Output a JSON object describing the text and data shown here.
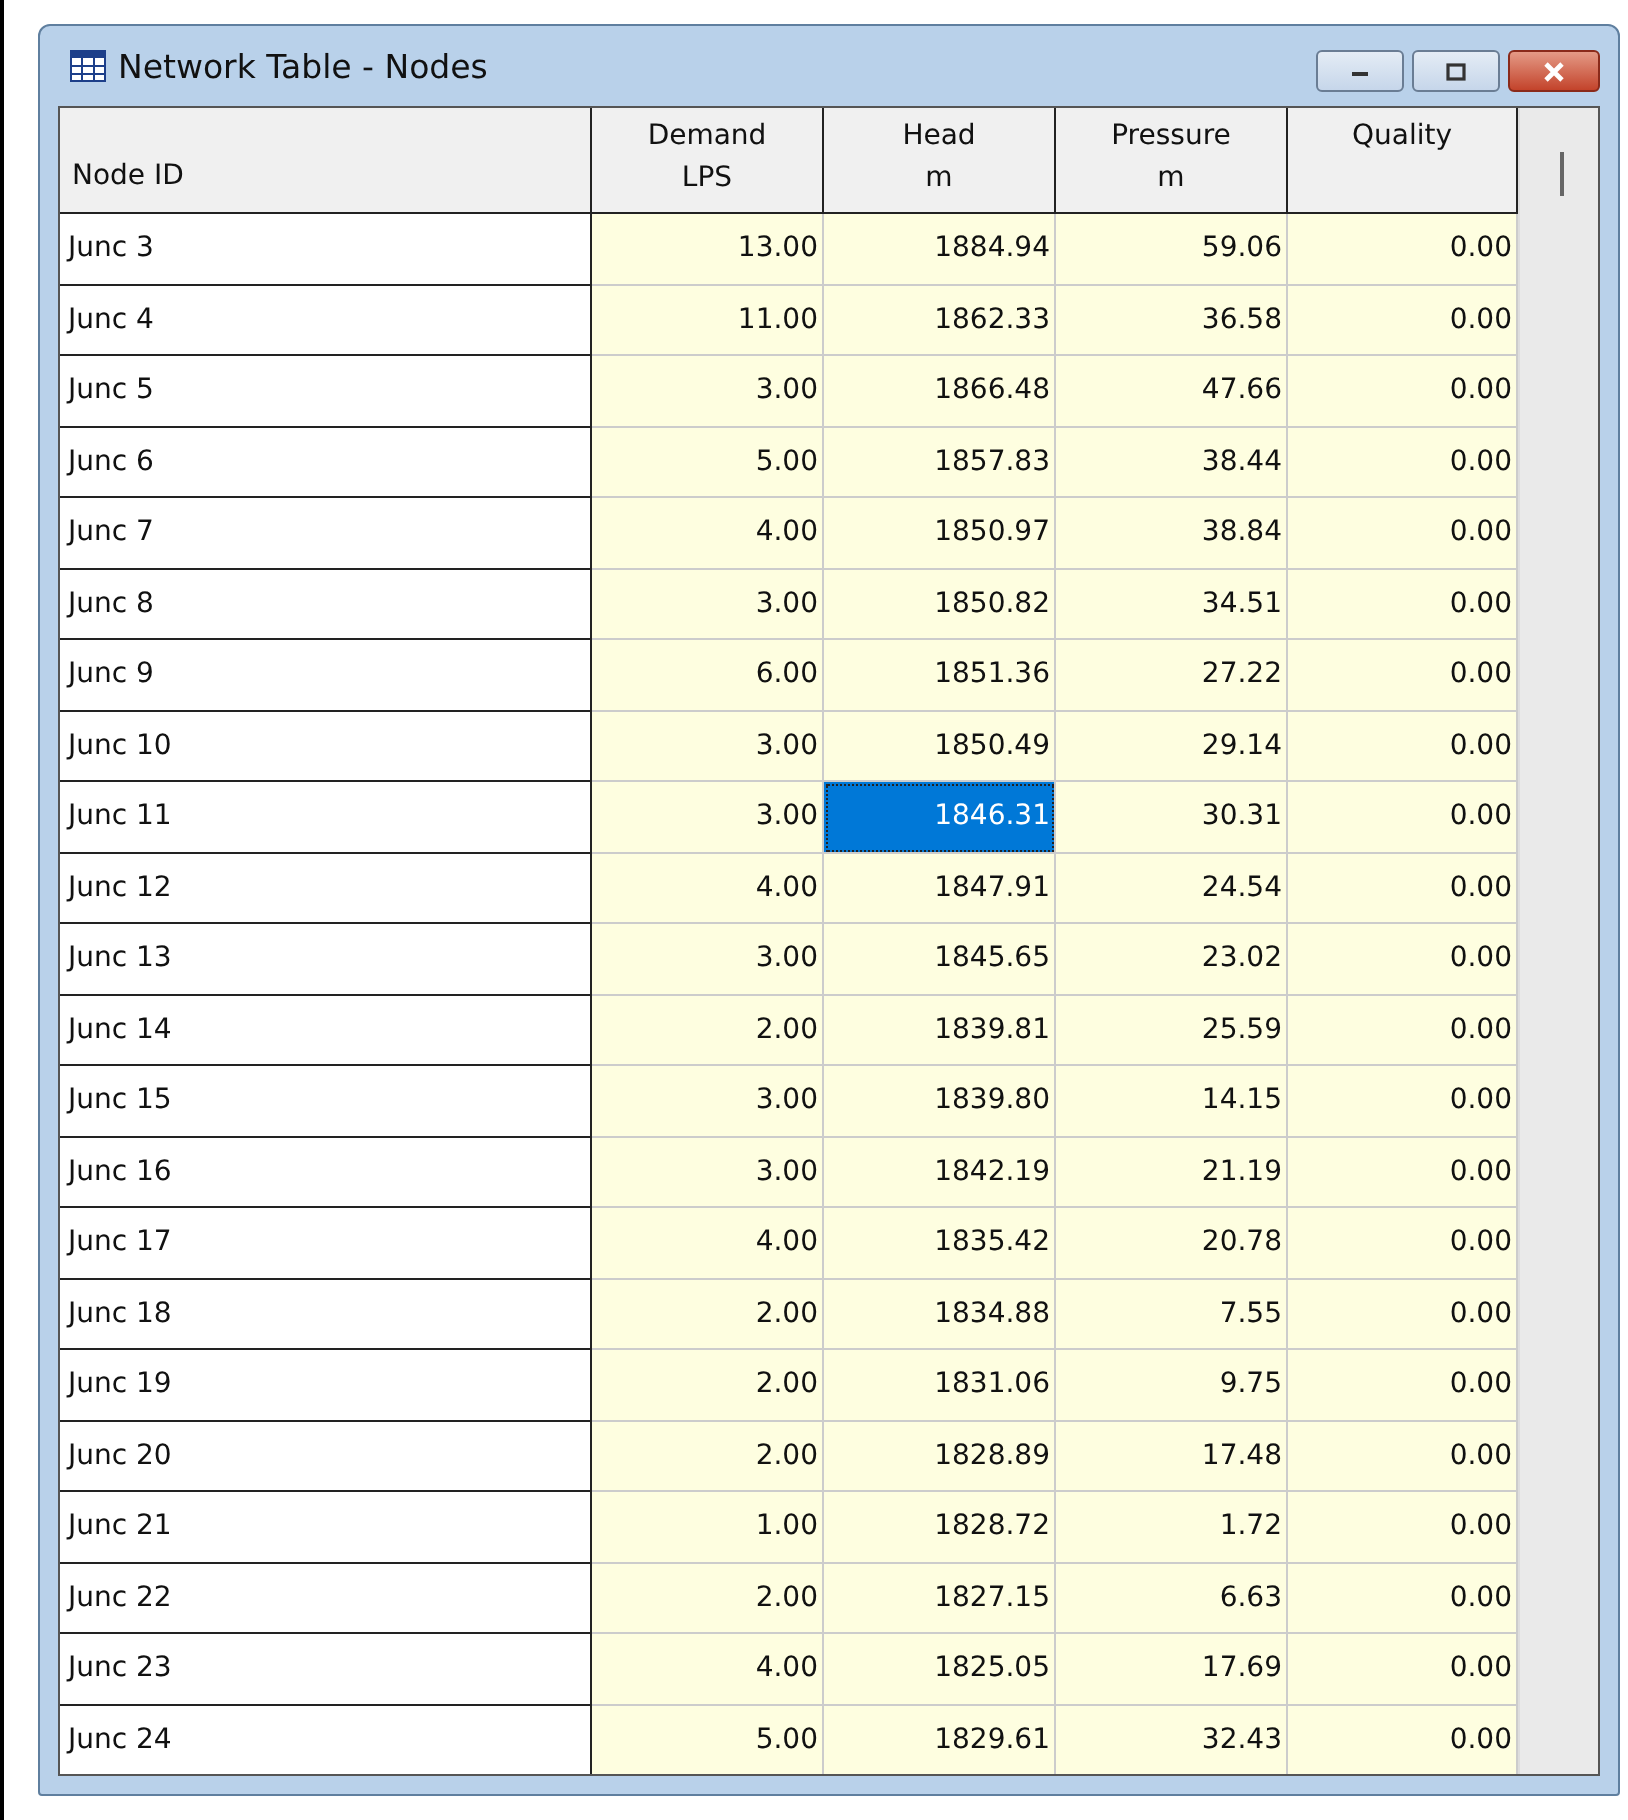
{
  "window": {
    "title": "Network Table - Nodes"
  },
  "table": {
    "columns": [
      {
        "lines": [
          "Node ID"
        ]
      },
      {
        "lines": [
          "Demand",
          "LPS"
        ]
      },
      {
        "lines": [
          "Head",
          "m"
        ]
      },
      {
        "lines": [
          "Pressure",
          "m"
        ]
      },
      {
        "lines": [
          "Quality"
        ]
      }
    ],
    "rows": [
      {
        "id": "Junc 3",
        "cells": [
          {
            "value": "13.00",
            "selected": false
          },
          {
            "value": "1884.94",
            "selected": false
          },
          {
            "value": "59.06",
            "selected": false
          },
          {
            "value": "0.00",
            "selected": false
          }
        ]
      },
      {
        "id": "Junc 4",
        "cells": [
          {
            "value": "11.00",
            "selected": false
          },
          {
            "value": "1862.33",
            "selected": false
          },
          {
            "value": "36.58",
            "selected": false
          },
          {
            "value": "0.00",
            "selected": false
          }
        ]
      },
      {
        "id": "Junc 5",
        "cells": [
          {
            "value": "3.00",
            "selected": false
          },
          {
            "value": "1866.48",
            "selected": false
          },
          {
            "value": "47.66",
            "selected": false
          },
          {
            "value": "0.00",
            "selected": false
          }
        ]
      },
      {
        "id": "Junc 6",
        "cells": [
          {
            "value": "5.00",
            "selected": false
          },
          {
            "value": "1857.83",
            "selected": false
          },
          {
            "value": "38.44",
            "selected": false
          },
          {
            "value": "0.00",
            "selected": false
          }
        ]
      },
      {
        "id": "Junc 7",
        "cells": [
          {
            "value": "4.00",
            "selected": false
          },
          {
            "value": "1850.97",
            "selected": false
          },
          {
            "value": "38.84",
            "selected": false
          },
          {
            "value": "0.00",
            "selected": false
          }
        ]
      },
      {
        "id": "Junc 8",
        "cells": [
          {
            "value": "3.00",
            "selected": false
          },
          {
            "value": "1850.82",
            "selected": false
          },
          {
            "value": "34.51",
            "selected": false
          },
          {
            "value": "0.00",
            "selected": false
          }
        ]
      },
      {
        "id": "Junc 9",
        "cells": [
          {
            "value": "6.00",
            "selected": false
          },
          {
            "value": "1851.36",
            "selected": false
          },
          {
            "value": "27.22",
            "selected": false
          },
          {
            "value": "0.00",
            "selected": false
          }
        ]
      },
      {
        "id": "Junc 10",
        "cells": [
          {
            "value": "3.00",
            "selected": false
          },
          {
            "value": "1850.49",
            "selected": false
          },
          {
            "value": "29.14",
            "selected": false
          },
          {
            "value": "0.00",
            "selected": false
          }
        ]
      },
      {
        "id": "Junc 11",
        "cells": [
          {
            "value": "3.00",
            "selected": false
          },
          {
            "value": "1846.31",
            "selected": true
          },
          {
            "value": "30.31",
            "selected": false
          },
          {
            "value": "0.00",
            "selected": false
          }
        ]
      },
      {
        "id": "Junc 12",
        "cells": [
          {
            "value": "4.00",
            "selected": false
          },
          {
            "value": "1847.91",
            "selected": false
          },
          {
            "value": "24.54",
            "selected": false
          },
          {
            "value": "0.00",
            "selected": false
          }
        ]
      },
      {
        "id": "Junc 13",
        "cells": [
          {
            "value": "3.00",
            "selected": false
          },
          {
            "value": "1845.65",
            "selected": false
          },
          {
            "value": "23.02",
            "selected": false
          },
          {
            "value": "0.00",
            "selected": false
          }
        ]
      },
      {
        "id": "Junc 14",
        "cells": [
          {
            "value": "2.00",
            "selected": false
          },
          {
            "value": "1839.81",
            "selected": false
          },
          {
            "value": "25.59",
            "selected": false
          },
          {
            "value": "0.00",
            "selected": false
          }
        ]
      },
      {
        "id": "Junc 15",
        "cells": [
          {
            "value": "3.00",
            "selected": false
          },
          {
            "value": "1839.80",
            "selected": false
          },
          {
            "value": "14.15",
            "selected": false
          },
          {
            "value": "0.00",
            "selected": false
          }
        ]
      },
      {
        "id": "Junc 16",
        "cells": [
          {
            "value": "3.00",
            "selected": false
          },
          {
            "value": "1842.19",
            "selected": false
          },
          {
            "value": "21.19",
            "selected": false
          },
          {
            "value": "0.00",
            "selected": false
          }
        ]
      },
      {
        "id": "Junc 17",
        "cells": [
          {
            "value": "4.00",
            "selected": false
          },
          {
            "value": "1835.42",
            "selected": false
          },
          {
            "value": "20.78",
            "selected": false
          },
          {
            "value": "0.00",
            "selected": false
          }
        ]
      },
      {
        "id": "Junc 18",
        "cells": [
          {
            "value": "2.00",
            "selected": false
          },
          {
            "value": "1834.88",
            "selected": false
          },
          {
            "value": "7.55",
            "selected": false
          },
          {
            "value": "0.00",
            "selected": false
          }
        ]
      },
      {
        "id": "Junc 19",
        "cells": [
          {
            "value": "2.00",
            "selected": false
          },
          {
            "value": "1831.06",
            "selected": false
          },
          {
            "value": "9.75",
            "selected": false
          },
          {
            "value": "0.00",
            "selected": false
          }
        ]
      },
      {
        "id": "Junc 20",
        "cells": [
          {
            "value": "2.00",
            "selected": false
          },
          {
            "value": "1828.89",
            "selected": false
          },
          {
            "value": "17.48",
            "selected": false
          },
          {
            "value": "0.00",
            "selected": false
          }
        ]
      },
      {
        "id": "Junc 21",
        "cells": [
          {
            "value": "1.00",
            "selected": false
          },
          {
            "value": "1828.72",
            "selected": false
          },
          {
            "value": "1.72",
            "selected": false
          },
          {
            "value": "0.00",
            "selected": false
          }
        ]
      },
      {
        "id": "Junc 22",
        "cells": [
          {
            "value": "2.00",
            "selected": false
          },
          {
            "value": "1827.15",
            "selected": false
          },
          {
            "value": "6.63",
            "selected": false
          },
          {
            "value": "0.00",
            "selected": false
          }
        ]
      },
      {
        "id": "Junc 23",
        "cells": [
          {
            "value": "4.00",
            "selected": false
          },
          {
            "value": "1825.05",
            "selected": false
          },
          {
            "value": "17.69",
            "selected": false
          },
          {
            "value": "0.00",
            "selected": false
          }
        ]
      },
      {
        "id": "Junc 24",
        "cells": [
          {
            "value": "5.00",
            "selected": false
          },
          {
            "value": "1829.61",
            "selected": false
          },
          {
            "value": "32.43",
            "selected": false
          },
          {
            "value": "0.00",
            "selected": false
          }
        ]
      }
    ]
  }
}
